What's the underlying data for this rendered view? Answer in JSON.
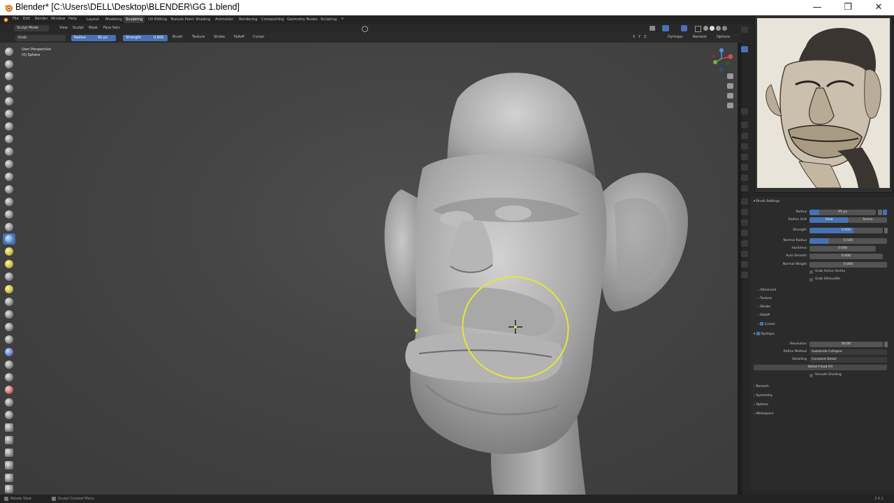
{
  "window": {
    "title": "Blender* [C:\\Users\\DELL\\Desktop\\BLENDER\\GG 1.blend]",
    "minimize_glyph": "—",
    "maximize_glyph": "❐",
    "close_glyph": "✕"
  },
  "menubar": {
    "menus": [
      "File",
      "Edit",
      "Render",
      "Window",
      "Help"
    ],
    "workspaces": [
      "Layout",
      "Modeling",
      "Sculpting",
      "UV Editing",
      "Texture Paint",
      "Shading",
      "Animation",
      "Rendering",
      "Compositing",
      "Geometry Nodes",
      "Scripting"
    ],
    "active_workspace": "Sculpting",
    "add_tab": "+"
  },
  "header": {
    "mode": "Sculpt Mode",
    "menus": [
      "View",
      "Sculpt",
      "Mask",
      "Face Sets"
    ],
    "brush_name": "Grab",
    "radius_label": "Radius",
    "radius_value": "95 px",
    "strength_label": "Strength",
    "strength_value": "0.600",
    "tool_menus": [
      "Brush",
      "Texture",
      "Stroke",
      "Falloff",
      "Cursor"
    ],
    "axis_buttons": [
      "X",
      "Y",
      "Z"
    ],
    "dyntopo": "Dyntopo",
    "remesh": "Remesh",
    "options": "Options"
  },
  "viewport": {
    "view_label": "User Perspective",
    "object_label": "(0) Sphere"
  },
  "properties": {
    "section_brush_settings": "Brush Settings",
    "radius_label": "Radius",
    "radius_value": "95 px",
    "radius_unit_label": "Radius Unit",
    "radius_unit_options": [
      "View",
      "Scene"
    ],
    "strength_label": "Strength",
    "strength_value": "0.600",
    "strength_fraction": 0.6,
    "normal_radius_label": "Normal Radius",
    "normal_radius_value": "0.500",
    "normal_radius_fraction": 0.5,
    "hardness_label": "Hardness",
    "hardness_value": "0.000",
    "autosmooth_label": "Auto Smooth",
    "autosmooth_value": "0.000",
    "normal_weight_label": "Normal Weight",
    "normal_weight_value": "0.000",
    "grab_active_vertex": "Grab Active Vertex",
    "grab_silhouette": "Grab Silhouette",
    "subsections": [
      "Advanced",
      "Texture",
      "Stroke",
      "Falloff",
      "Cursor"
    ],
    "dyntopo": "Dyntopo",
    "resolution_label": "Resolution",
    "resolution_value": "50.00",
    "refine_method_label": "Refine Method",
    "refine_method_value": "Subdivide Collapse",
    "detailing_label": "Detailing",
    "detailing_value": "Constant Detail",
    "detail_flood_fill": "Detail Flood Fill",
    "smooth_shading": "Smooth Shading",
    "bottom_sections": [
      "Remesh",
      "Symmetry",
      "Options",
      "Workspace"
    ]
  },
  "statusbar": {
    "left_item": "Rotate View",
    "middle_item": "Sculpt Context Menu",
    "version": "3.4.1"
  },
  "colors": {
    "accent_blue": "#4772b3",
    "brush_circle": "#e2e836",
    "viewport_bg": "#444444"
  }
}
